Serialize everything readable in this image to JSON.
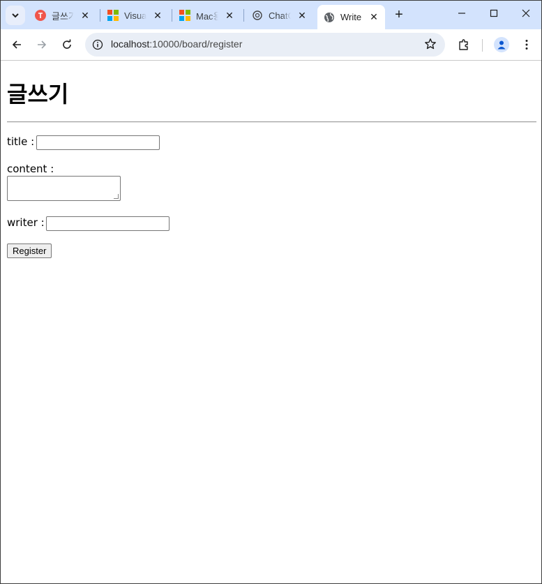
{
  "browser": {
    "tabs": [
      {
        "title": "글쓰기",
        "icon": "red-circle-icon"
      },
      {
        "title": "Visual",
        "icon": "microsoft-logo-icon"
      },
      {
        "title": "Mac용",
        "icon": "microsoft-logo-icon"
      },
      {
        "title": "ChatG",
        "icon": "openai-icon"
      },
      {
        "title": "Write",
        "icon": "globe-icon",
        "active": true
      }
    ],
    "address": "localhost:10000/board/register",
    "address_host": "localhost",
    "address_rest": ":10000/board/register"
  },
  "page": {
    "heading": "글쓰기",
    "form": {
      "title_label": "title :",
      "content_label": "content :",
      "writer_label": "writer :",
      "title_value": "",
      "content_value": "",
      "writer_value": "",
      "submit_label": "Register"
    }
  },
  "colors": {
    "tabstrip": "#d3e3fd",
    "omnibox": "#e9eef6"
  }
}
